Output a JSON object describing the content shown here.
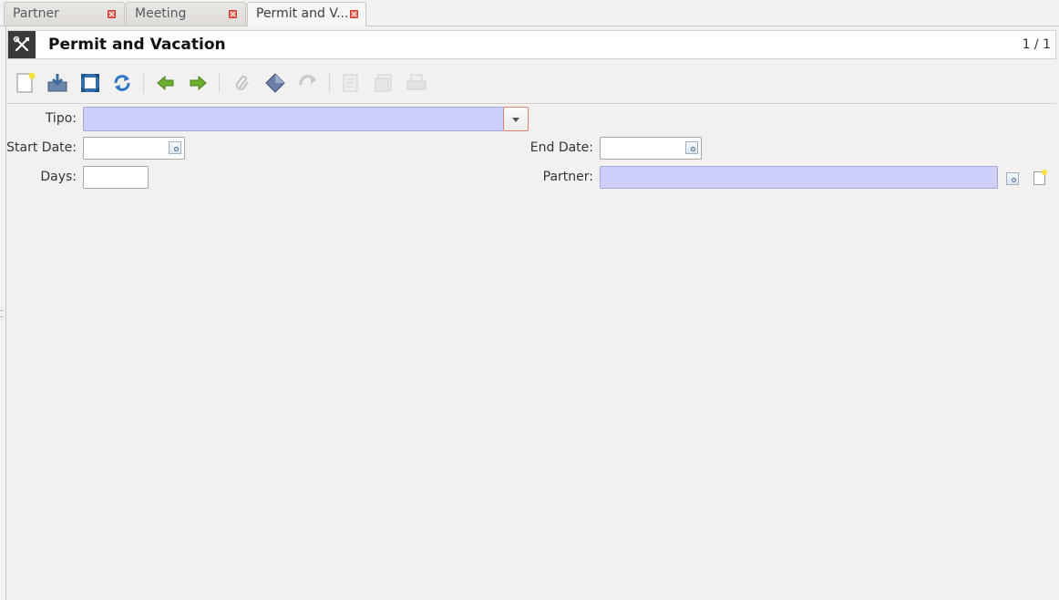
{
  "tabs": [
    {
      "label": "Partner"
    },
    {
      "label": "Meeting"
    },
    {
      "label": "Permit and V..."
    }
  ],
  "window": {
    "title": "Permit and Vacation",
    "record_counter": "1 / 1"
  },
  "toolbar": {
    "icons": [
      "new-icon",
      "save-icon",
      "fullscreen-icon",
      "reload-icon",
      "previous-icon",
      "next-icon",
      "attachment-icon",
      "action-icon",
      "relate-icon",
      "report-icon",
      "email-icon",
      "print-icon"
    ]
  },
  "form": {
    "tipo_label": "Tipo:",
    "tipo_value": "",
    "start_date_label": "Start Date:",
    "start_date_value": "",
    "end_date_label": "End Date:",
    "end_date_value": "",
    "days_label": "Days:",
    "days_value": "",
    "partner_label": "Partner:",
    "partner_value": ""
  },
  "colors": {
    "required_field": "#cfcffc",
    "title_icon_bg": "#3a3a3a",
    "nav_arrow": "#6cae2f"
  }
}
